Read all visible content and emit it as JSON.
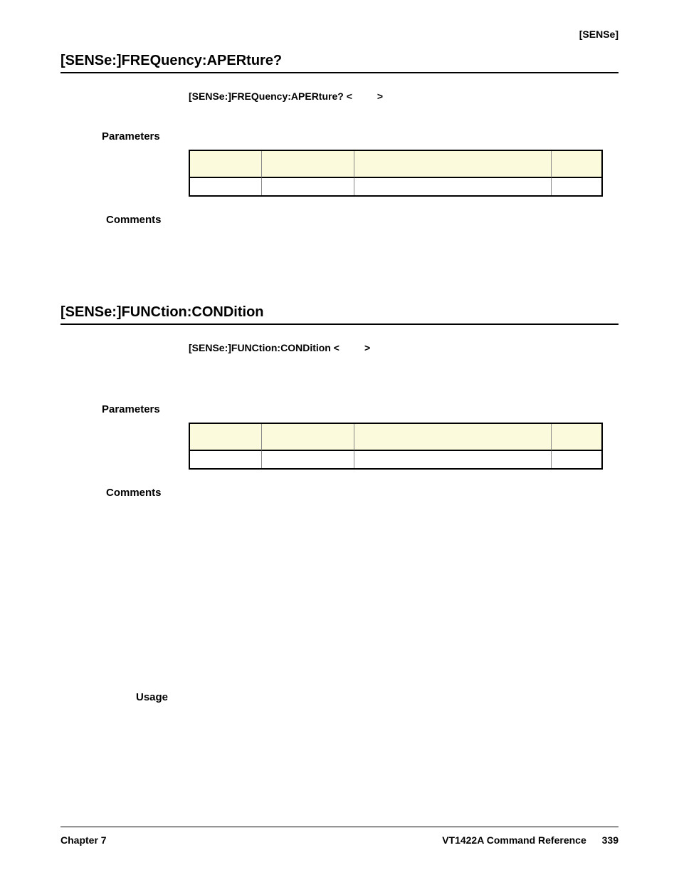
{
  "header": {
    "right": "[SENSe]"
  },
  "section1": {
    "title": "[SENSe:]FREQuency:APERture?",
    "syntax_bold": "[SENSe:]FREQuency:APERture? <",
    "syntax_end": ">",
    "parameters_label": "Parameters",
    "comments_label": "Comments"
  },
  "section2": {
    "title": "[SENSe:]FUNCtion:CONDition",
    "syntax_bold": "[SENSe:]FUNCtion:CONDition <",
    "syntax_end": ">",
    "parameters_label": "Parameters",
    "comments_label": "Comments",
    "usage_label": "Usage"
  },
  "footer": {
    "chapter": "Chapter 7",
    "doc_title": "VT1422A Command Reference",
    "page": "339"
  }
}
